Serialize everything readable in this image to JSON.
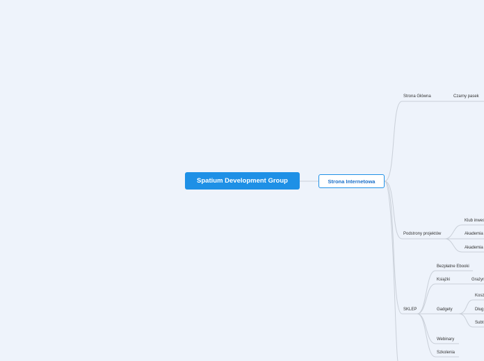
{
  "root": {
    "label": "Spatium Development Group"
  },
  "main": {
    "label": "Strona Internetowa"
  },
  "branches": {
    "strona_glowna": {
      "label": "Strona Główna",
      "child": "Czarny pasek"
    },
    "podstrony": {
      "label": "Podstrony projektów",
      "children": [
        "Klub inwes",
        "Akademia",
        "Akademia"
      ]
    },
    "sklep": {
      "label": "SKLEP",
      "children": [
        "Bezpłatne Ebooki",
        "Książki",
        "Gadgety",
        "Webinary",
        "Szkolenia"
      ],
      "ksiazki_child": "Grażyn",
      "gadgety_children": [
        "Kosz",
        "Dług",
        "Subt"
      ]
    }
  },
  "colors": {
    "root_fill": "#1e90e6",
    "background": "#eef3fb",
    "line": "#c9cfd8"
  }
}
